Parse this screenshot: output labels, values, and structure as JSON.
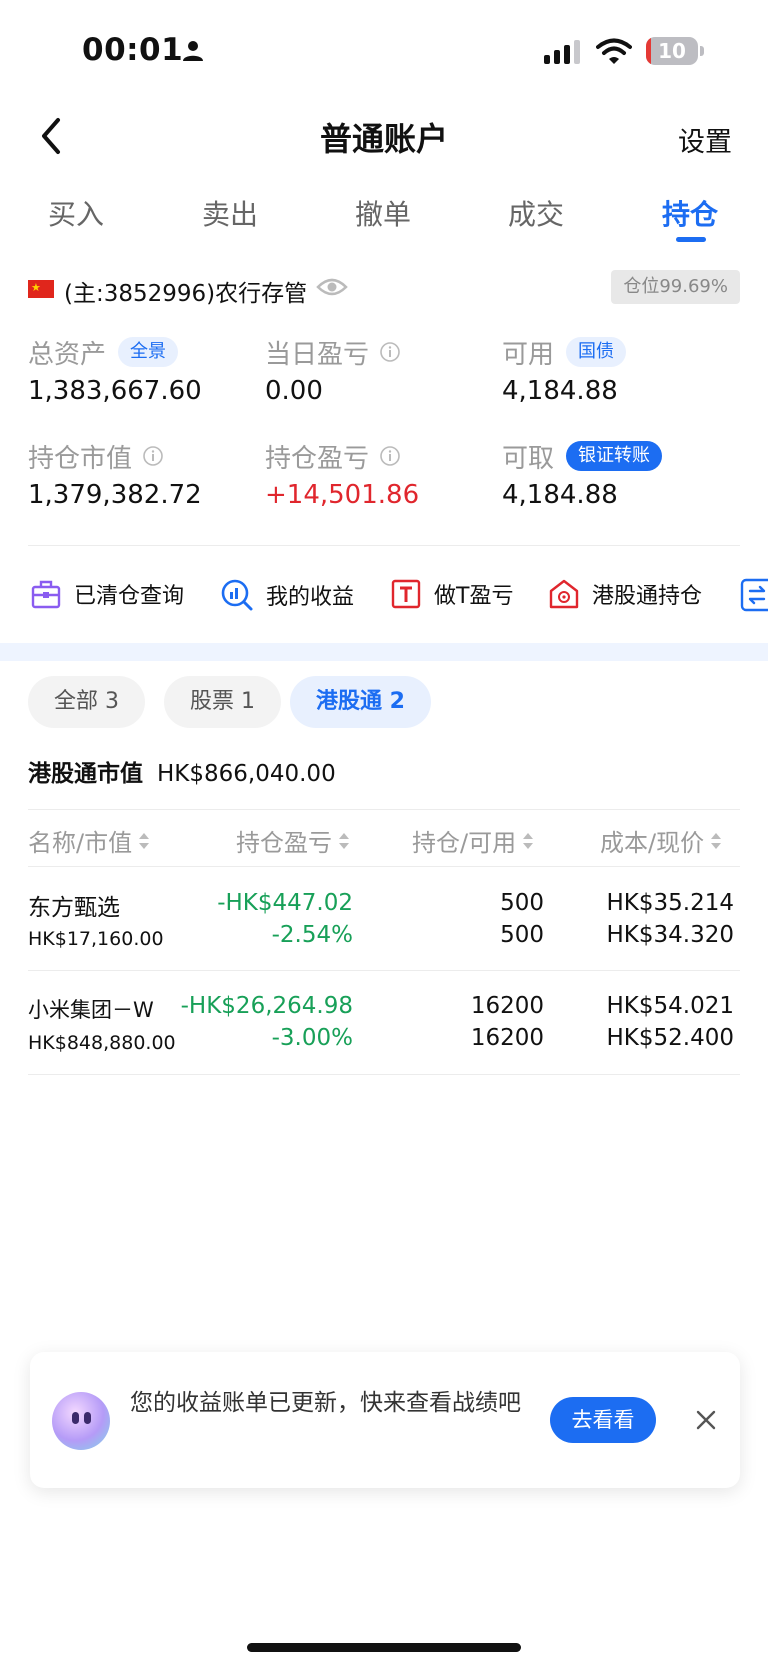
{
  "status_bar": {
    "time": "00:01",
    "battery": "10",
    "battery_level": 0.1,
    "battery_color": "#e53935"
  },
  "nav": {
    "title": "普通账户",
    "settings": "设置",
    "back_icon": "chevron-left-icon"
  },
  "tabs": [
    {
      "label": "买入",
      "active": false
    },
    {
      "label": "卖出",
      "active": false
    },
    {
      "label": "撤单",
      "active": false
    },
    {
      "label": "成交",
      "active": false
    },
    {
      "label": "持仓",
      "active": true
    }
  ],
  "account": {
    "label": "(主:3852996)农行存管",
    "position_badge": "仓位99.69%",
    "flag_icon": "china-flag-icon",
    "eye_icon": "eye-icon"
  },
  "metrics": {
    "total_assets": {
      "label": "总资产",
      "value": "1,383,667.60",
      "pill": "全景"
    },
    "daily_pnl": {
      "label": "当日盈亏",
      "value": "0.00"
    },
    "available": {
      "label": "可用",
      "value": "4,184.88",
      "pill": "国债"
    },
    "market_value": {
      "label": "持仓市值",
      "value": "1,379,382.72"
    },
    "holding_pnl": {
      "label": "持仓盈亏",
      "value": "+14,501.86"
    },
    "withdrawable": {
      "label": "可取",
      "value": "4,184.88",
      "pill": "银证转账"
    }
  },
  "quick_links": [
    {
      "label": "已清仓查询",
      "icon": "briefcase-icon"
    },
    {
      "label": "我的收益",
      "icon": "chart-search-icon"
    },
    {
      "label": "做T盈亏",
      "icon": "t-box-icon"
    },
    {
      "label": "港股通持仓",
      "icon": "hk-flower-icon"
    }
  ],
  "filters": [
    {
      "label": "全部 3",
      "active": false
    },
    {
      "label": "股票 1",
      "active": false
    },
    {
      "label": "港股通 2",
      "active": true
    }
  ],
  "market_summary": {
    "label": "港股通市值",
    "value": "HK$866,040.00"
  },
  "columns": [
    "名称/市值",
    "持仓盈亏",
    "持仓/可用",
    "成本/现价"
  ],
  "holdings": [
    {
      "name": "东方甄选",
      "market_value": "HK$17,160.00",
      "pnl": "-HK$447.02",
      "pnl_pct": "-2.54%",
      "qty": "500",
      "available": "500",
      "cost": "HK$35.214",
      "price": "HK$34.320"
    },
    {
      "name": "小米集团－W",
      "market_value": "HK$848,880.00",
      "pnl": "-HK$26,264.98",
      "pnl_pct": "-3.00%",
      "qty": "16200",
      "available": "16200",
      "cost": "HK$54.021",
      "price": "HK$52.400"
    }
  ],
  "toast": {
    "message": "您的收益账单已更新，快来查看战绩吧",
    "button": "去看看"
  },
  "colors": {
    "accent": "#1c6df2",
    "gain": "#e0262d",
    "loss": "#18a058"
  }
}
